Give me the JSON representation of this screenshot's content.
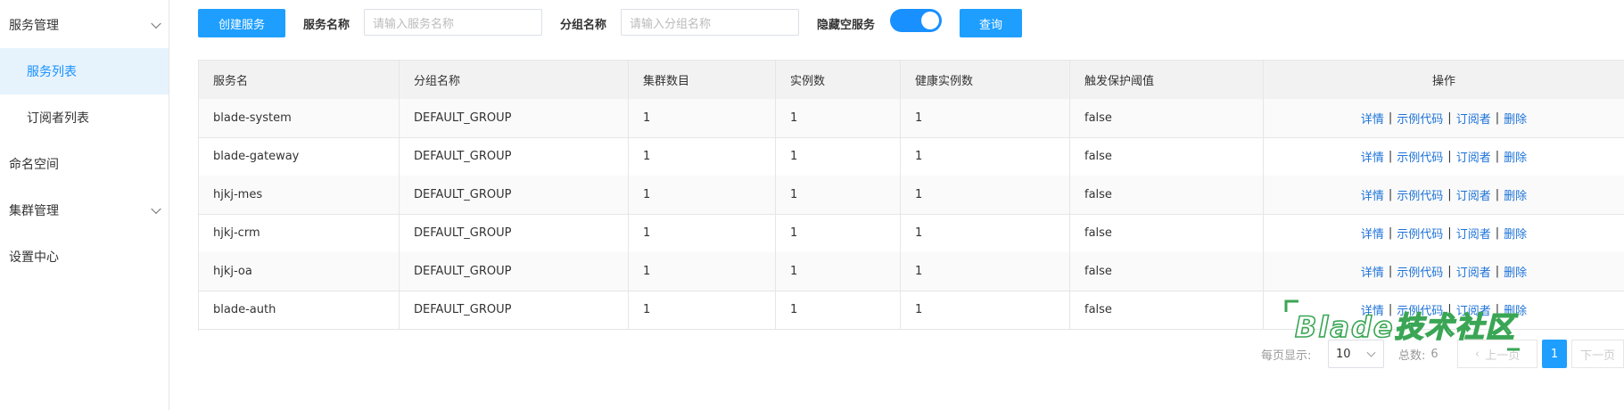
{
  "sidebar": {
    "items": [
      {
        "label": "服务管理",
        "expandable": true
      },
      {
        "label": "服务列表",
        "active": true
      },
      {
        "label": "订阅者列表"
      },
      {
        "label": "命名空间"
      },
      {
        "label": "集群管理",
        "expandable": true
      },
      {
        "label": "设置中心"
      }
    ]
  },
  "toolbar": {
    "create_button": "创建服务",
    "service_name_label": "服务名称",
    "service_name_placeholder": "请输入服务名称",
    "group_name_label": "分组名称",
    "group_name_placeholder": "请输入分组名称",
    "hide_empty_label": "隐藏空服务",
    "hide_empty_on": true,
    "query_button": "查询"
  },
  "table": {
    "columns": [
      "服务名",
      "分组名称",
      "集群数目",
      "实例数",
      "健康实例数",
      "触发保护阈值",
      "操作"
    ],
    "rows": [
      [
        "blade-system",
        "DEFAULT_GROUP",
        "1",
        "1",
        "1",
        "false"
      ],
      [
        "blade-gateway",
        "DEFAULT_GROUP",
        "1",
        "1",
        "1",
        "false"
      ],
      [
        "hjkj-mes",
        "DEFAULT_GROUP",
        "1",
        "1",
        "1",
        "false"
      ],
      [
        "hjkj-crm",
        "DEFAULT_GROUP",
        "1",
        "1",
        "1",
        "false"
      ],
      [
        "hjkj-oa",
        "DEFAULT_GROUP",
        "1",
        "1",
        "1",
        "false"
      ],
      [
        "blade-auth",
        "DEFAULT_GROUP",
        "1",
        "1",
        "1",
        "false"
      ]
    ],
    "actions": [
      "详情",
      "示例代码",
      "订阅者",
      "删除"
    ],
    "action_separator": "|"
  },
  "pagination": {
    "page_size_label": "每页显示:",
    "page_size": "10",
    "total_label": "总数:",
    "total": "6",
    "prev": "上一页",
    "current_page": "1",
    "next": "下一页"
  },
  "watermark": "Blade技术社区",
  "colors": {
    "accent": "#1e9fff",
    "link": "#1e73d8",
    "active_bg": "#e6f3fd",
    "watermark": "#3aa655"
  }
}
